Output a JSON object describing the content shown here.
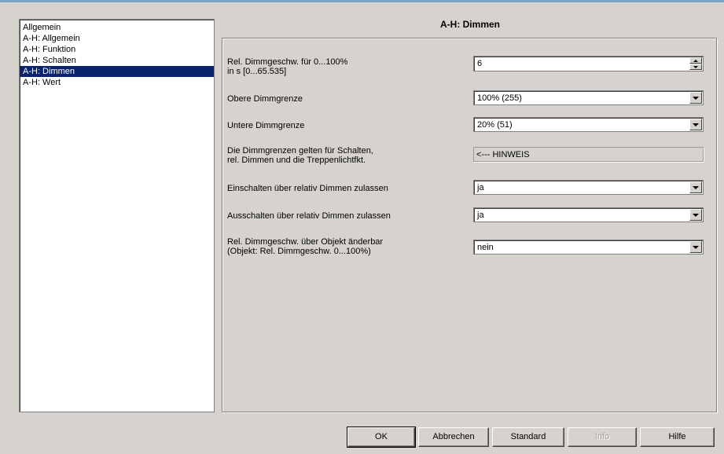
{
  "sidebar": {
    "items": [
      {
        "label": "Allgemein"
      },
      {
        "label": "A-H: Allgemein"
      },
      {
        "label": "A-H: Funktion"
      },
      {
        "label": "A-H: Schalten"
      },
      {
        "label": "A-H: Dimmen",
        "selected": true
      },
      {
        "label": "A-H: Wert"
      }
    ]
  },
  "section": {
    "title": "A-H: Dimmen"
  },
  "params": [
    {
      "label1": "Rel. Dimmgeschw. für 0...100%",
      "label2": "in s [0...65.535]",
      "type": "spinner",
      "value": "6"
    },
    {
      "label1": "Obere Dimmgrenze",
      "type": "dropdown",
      "value": "100% (255)"
    },
    {
      "label1": "Untere Dimmgrenze",
      "type": "dropdown",
      "value": "20%  (51)"
    },
    {
      "label1": "Die Dimmgrenzen gelten für Schalten,",
      "label2": "rel. Dimmen und die Treppenlichtfkt.",
      "type": "readonly",
      "value": "<--- HINWEIS"
    },
    {
      "label1": "Einschalten über relativ Dimmen zulassen",
      "type": "dropdown",
      "value": "ja"
    },
    {
      "label1": "Ausschalten über relativ Dimmen zulassen",
      "type": "dropdown",
      "value": "ja"
    },
    {
      "label1": "Rel. Dimmgeschw. über Objekt änderbar",
      "label2": "(Objekt: Rel. Dimmgeschw. 0...100%)",
      "type": "dropdown",
      "value": "nein"
    }
  ],
  "buttons": {
    "ok": "OK",
    "cancel": "Abbrechen",
    "standard": "Standard",
    "info": "Info",
    "help": "Hilfe"
  },
  "colors": {
    "selection": "#0a246a",
    "window_bg": "#d6d3ce"
  }
}
